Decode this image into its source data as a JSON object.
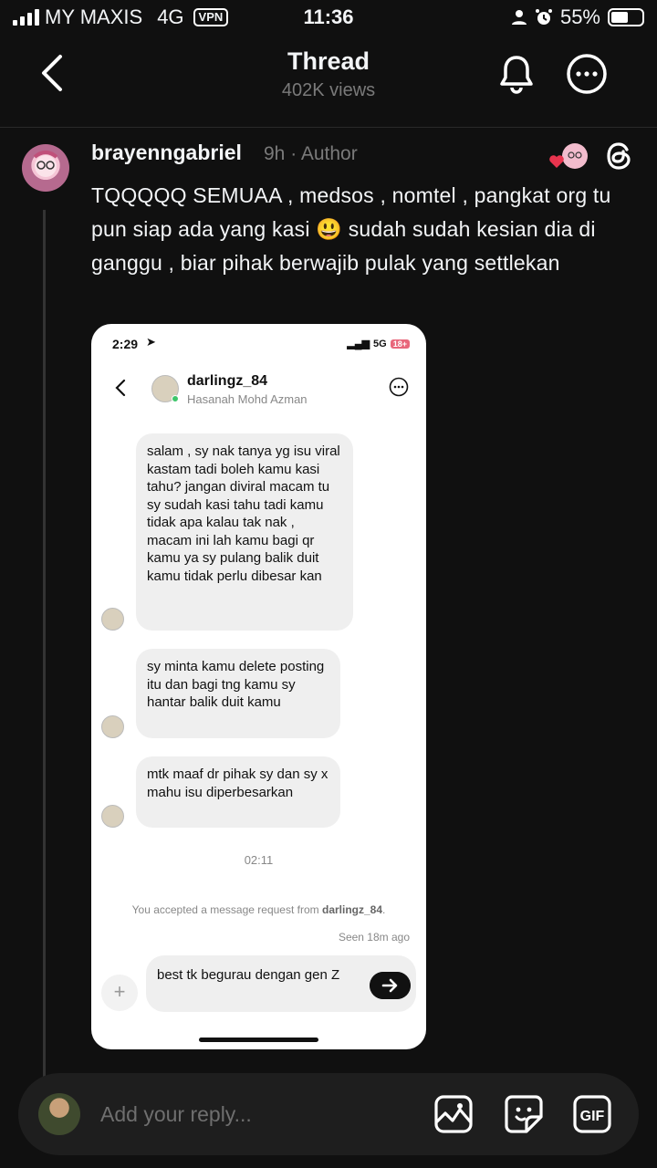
{
  "status_bar": {
    "carrier": "MY MAXIS",
    "network": "4G",
    "vpn": "VPN",
    "time": "11:36",
    "battery": "55%"
  },
  "header": {
    "title": "Thread",
    "views": "402K views"
  },
  "post": {
    "username": "brayenngabriel",
    "meta": "9h · Author",
    "text": "TQQQQQ SEMUAA , medsos , nomtel , pangkat org tu pun siap ada yang kasi 😃 sudah sudah kesian dia di ganggu , biar pihak berwajib pulak yang settlekan"
  },
  "screenshot": {
    "time": "2:29",
    "network": "5G",
    "battery": "18+",
    "contact_username": "darlingz_84",
    "contact_name": "Hasanah Mohd Azman",
    "messages": [
      "salam ,  sy nak tanya yg isu viral kastam tadi boleh kamu kasi tahu? jangan diviral macam tu sy sudah kasi tahu tadi kamu tidak apa kalau tak nak , macam ini lah kamu bagi qr kamu ya sy pulang balik duit kamu tidak perlu dibesar kan",
      "sy minta kamu delete posting itu dan bagi tng kamu sy hantar balik duit kamu",
      "mtk maaf dr pihak sy dan sy x mahu isu diperbesarkan"
    ],
    "timestamp": "02:11",
    "accepted_prefix": "You accepted a message request from",
    "accepted_user": "darlingz_84",
    "seen": "Seen 18m ago",
    "draft": "best tk begurau dengan gen Z"
  },
  "reply_bar": {
    "placeholder": "Add your reply..."
  },
  "colors": {
    "background": "#101010",
    "like_heart": "#e8344e"
  }
}
